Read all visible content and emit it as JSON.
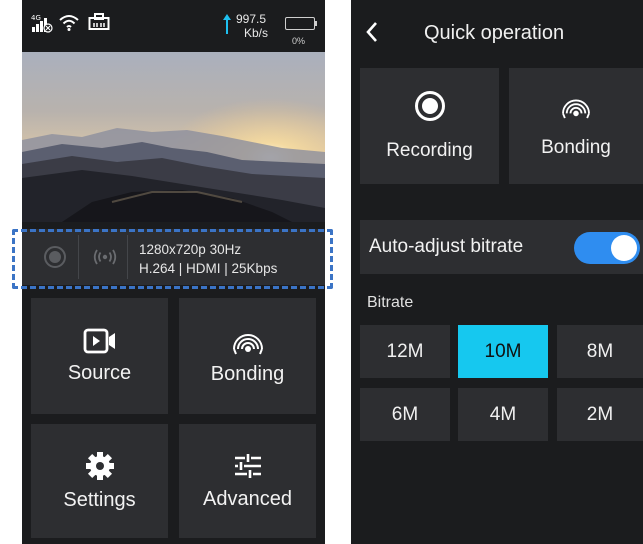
{
  "left_screen": {
    "status_bar": {
      "network_badge": "4G",
      "upload_rate_value": "997.5",
      "upload_rate_unit": "Kb/s",
      "battery_percent": "0%"
    },
    "stream_info": {
      "line1": "1280x720p 30Hz",
      "line2": "H.264 | HDMI | 25Kbps"
    },
    "menu": [
      {
        "label": "Source",
        "icon": "video-camera-icon"
      },
      {
        "label": "Bonding",
        "icon": "bonding-signal-icon"
      },
      {
        "label": "Settings",
        "icon": "gear-icon"
      },
      {
        "label": "Advanced",
        "icon": "sliders-icon"
      }
    ]
  },
  "right_screen": {
    "title": "Quick operation",
    "tiles": [
      {
        "label": "Recording",
        "icon": "record-icon"
      },
      {
        "label": "Bonding",
        "icon": "bonding-signal-icon"
      }
    ],
    "auto_adjust": {
      "label": "Auto-adjust bitrate",
      "enabled": true
    },
    "bitrate_label": "Bitrate",
    "bitrate_options": [
      "12M",
      "10M",
      "8M",
      "6M",
      "4M",
      "2M"
    ],
    "selected_bitrate": "10M"
  },
  "colors": {
    "panel_bg": "#1b1c1e",
    "tile_bg": "#2d2e31",
    "selected_bitrate": "#16c8ef",
    "toggle_on": "#2f8df0",
    "highlight_dash": "#3b74c6",
    "upload_arrow": "#1ec0f0"
  }
}
